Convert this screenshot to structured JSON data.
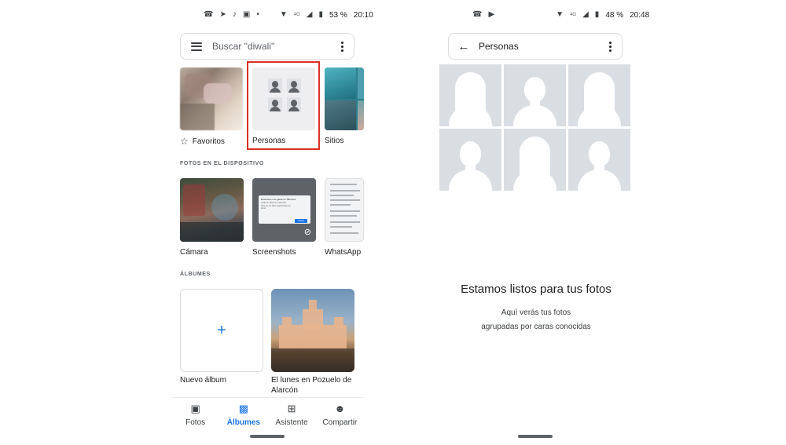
{
  "left_screen": {
    "status_bar": {
      "icons": [
        "whatsapp-icon",
        "telegram-icon",
        "tiktok-icon",
        "instagram-icon",
        "dot-icon",
        "wifi-icon",
        "4g-icon",
        "signal-icon",
        "battery-icon"
      ],
      "network": "4G",
      "battery": "53 %",
      "time": "20:10"
    },
    "search": {
      "placeholder": "Buscar \"diwali\""
    },
    "categories": [
      {
        "label": "Favoritos"
      },
      {
        "label": "Personas"
      },
      {
        "label": "Sitios"
      }
    ],
    "device_section": {
      "header": "FOTOS EN EL DISPOSITIVO",
      "folders": [
        {
          "label": "Cámara"
        },
        {
          "label": "Screenshots"
        },
        {
          "label": "WhatsApp"
        }
      ],
      "screenshot_preview": {
        "title": "Reconoce a tu gente en Álbumes",
        "body": "Verás tus álbumes más tarde para ver tus fotos organizadas por caras",
        "button": "Probar"
      }
    },
    "albums_section": {
      "header": "ÁLBUMES",
      "albums": [
        {
          "label": "Nuevo álbum",
          "icon": "plus-icon"
        },
        {
          "label": "El lunes en Pozuelo de Alarcón"
        }
      ]
    },
    "bottom_nav": {
      "items": [
        {
          "label": "Fotos",
          "icon": "photo-icon",
          "active": false
        },
        {
          "label": "Álbumes",
          "icon": "albums-icon",
          "active": true
        },
        {
          "label": "Asistente",
          "icon": "assistant-icon",
          "active": false
        },
        {
          "label": "Compartir",
          "icon": "sharing-icon",
          "active": false
        }
      ]
    },
    "colors": {
      "accent": "#1a73e8",
      "highlight_border": "#d93025"
    }
  },
  "right_screen": {
    "status_bar": {
      "icons": [
        "whatsapp-icon",
        "play-icon",
        "wifi-icon",
        "4g-icon",
        "signal-icon",
        "battery-icon"
      ],
      "network": "4G",
      "battery": "48 %",
      "time": "20:48"
    },
    "header": {
      "title": "Personas"
    },
    "empty_state": {
      "title": "Estamos listos para tus fotos",
      "line1": "Aquí verás tus fotos",
      "line2": "agrupadas por caras conocidas"
    }
  }
}
